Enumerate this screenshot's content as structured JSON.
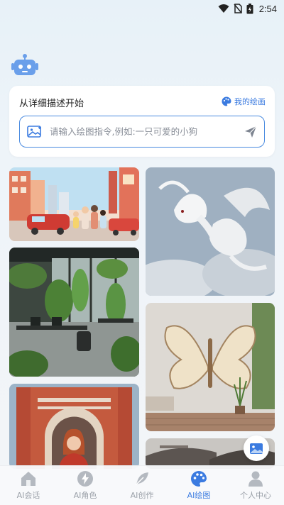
{
  "status": {
    "time": "2:54"
  },
  "card": {
    "title": "从详细描述开始",
    "my_paintings_label": "我的绘画",
    "input_placeholder": "请输入绘图指令,例如:一只可爱的小狗"
  },
  "gallery": {
    "left": [
      "city-street-family",
      "modern-office-plants",
      "red-brick-gate-portrait"
    ],
    "right": [
      "white-dragon-clouds",
      "paper-butterfly-wall",
      "chinese-rooftops"
    ]
  },
  "tabs": [
    {
      "label": "AI会话",
      "icon": "home-icon"
    },
    {
      "label": "AI角色",
      "icon": "bolt-icon"
    },
    {
      "label": "AI创作",
      "icon": "feather-icon"
    },
    {
      "label": "AI绘图",
      "icon": "palette-icon",
      "active": true
    },
    {
      "label": "个人中心",
      "icon": "person-icon"
    }
  ],
  "colors": {
    "accent": "#3b7be0",
    "inactive": "#9aa0a8"
  }
}
